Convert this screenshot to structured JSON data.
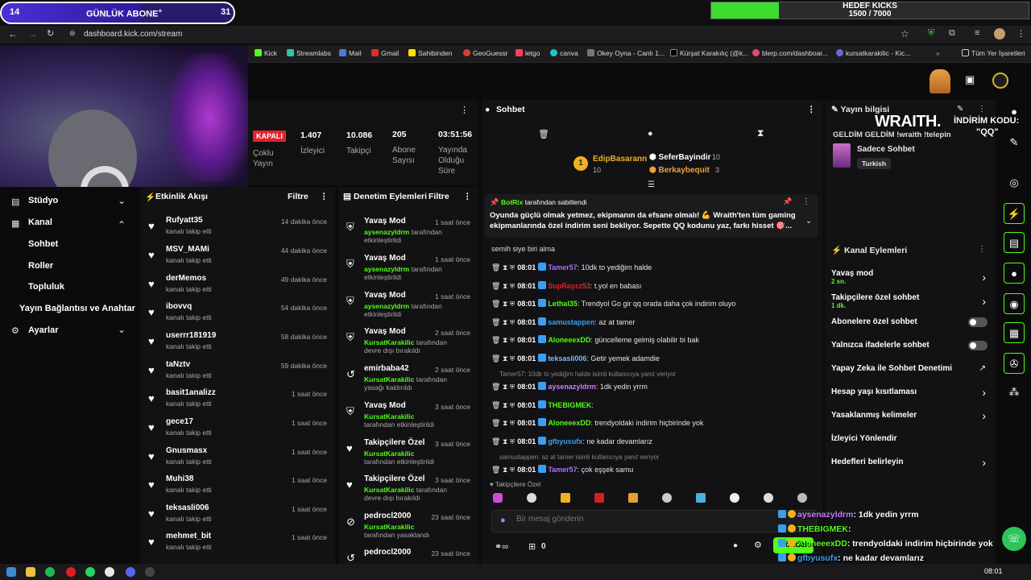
{
  "tab": {
    "left": "14",
    "middle": "GÜNLÜK ABONE",
    "middle_sup": "+",
    "right": "31",
    "progress": 0.6
  },
  "goal": {
    "title": "HEDEF KICKS",
    "value": "1500 / 7000",
    "progress": 0.214
  },
  "url": "dashboard.kick.com/stream",
  "bookmarks": [
    "Kick",
    "Streamlabs",
    "Mail",
    "Gmail",
    "Sahibinden",
    "GeoGuessr",
    "letgo",
    "canva",
    "Okey Oyna - Canlı 1...",
    "Kürşat Karakılıç (@k...",
    "blerp.com/dashboar...",
    "kursatkarakilic - Kic..."
  ],
  "bookmarks_folder": "Tüm Yer İşaretleri",
  "nav": {
    "studio": "Stüdyo",
    "kanal": "Kanal",
    "sohbet": "Sohbet",
    "roller": "Roller",
    "topluluk": "Topluluk",
    "yayin": "Yayın Bağlantısı ve Anahtar",
    "ayarlar": "Ayarlar"
  },
  "stats": {
    "status": "KAPALI",
    "status_label": "Çoklu Yayın",
    "viewers": "1.407",
    "viewers_label": "İzleyici",
    "followers": "10.086",
    "followers_label": "Takipçi",
    "subs": "205",
    "subs_label": "Abone Sayısı",
    "uptime": "03:51:56",
    "uptime_label": "Yayında Olduğu Süre"
  },
  "activity": {
    "title": "Etkinlik Akışı",
    "filter": "Filtre",
    "items": [
      {
        "name": "Rufyatt35",
        "sub": "kanalı takip etti",
        "time": "14 dakika önce"
      },
      {
        "name": "MSV_MAMi",
        "sub": "kanalı takip etti",
        "time": "44 dakika önce"
      },
      {
        "name": "derMemos",
        "sub": "kanalı takip etti",
        "time": "49 dakika önce"
      },
      {
        "name": "ibovvq",
        "sub": "kanalı takip etti",
        "time": "54 dakika önce"
      },
      {
        "name": "userrr181919",
        "sub": "kanalı takip etti",
        "time": "58 dakika önce"
      },
      {
        "name": "taNztv",
        "sub": "kanalı takip etti",
        "time": "59 dakika önce"
      },
      {
        "name": "basit1analizz",
        "sub": "kanalı takip etti",
        "time": "1 saat önce"
      },
      {
        "name": "gece17",
        "sub": "kanalı takip etti",
        "time": "1 saat önce"
      },
      {
        "name": "Gnusmasx",
        "sub": "kanalı takip etti",
        "time": "1 saat önce"
      },
      {
        "name": "Muhi38",
        "sub": "kanalı takip etti",
        "time": "1 saat önce"
      },
      {
        "name": "teksasli006",
        "sub": "kanalı takip etti",
        "time": "1 saat önce"
      },
      {
        "name": "mehmet_bit",
        "sub": "kanalı takip etti",
        "time": "1 saat önce"
      }
    ]
  },
  "mod": {
    "title": "Denetim Eylemleri",
    "filter": "Filtre",
    "items": [
      {
        "name": "Yavaş Mod",
        "user": "aysenazyldrm",
        "sub": " tarafından etkinleştirildi",
        "time": "1 saat önce"
      },
      {
        "name": "Yavaş Mod",
        "user": "aysenazyldrm",
        "sub": " tarafından etkinleştirildi",
        "time": "1 saat önce"
      },
      {
        "name": "Yavaş Mod",
        "user": "aysenazyldrm",
        "sub": " tarafından etkinleştirildi",
        "time": "1 saat önce"
      },
      {
        "name": "Yavaş Mod",
        "user": "KursatKarakilic",
        "sub": " tarafından devre dışı bırakıldı",
        "time": "2 saat önce"
      },
      {
        "name": "emirbaba42",
        "user": "KursatKarakilic",
        "sub": " tarafından yasağı kaldırıldı",
        "time": "2 saat önce"
      },
      {
        "name": "Yavaş Mod",
        "user": "KursatKarakilic",
        "sub": " tarafından etkinleştirildi",
        "time": "3 saat önce"
      },
      {
        "name": "Takipçilere Özel",
        "user": "KursatKarakilic",
        "sub": " tarafından etkinleştirildi",
        "time": "3 saat önce"
      },
      {
        "name": "Takipçilere Özel",
        "user": "KursatKarakilic",
        "sub": " tarafından devre dışı bırakıldı",
        "time": "3 saat önce"
      },
      {
        "name": "pedrocl2000",
        "user": "KursatKarakilic",
        "sub": " tarafından yasaklandı",
        "time": "23 saat önce"
      },
      {
        "name": "pedrocl2000",
        "user": "",
        "sub": "",
        "time": "23 saat önce"
      }
    ]
  },
  "chat": {
    "title": "Sohbet",
    "top": [
      {
        "name": "EdipBasarann",
        "n": "10"
      },
      {
        "name": "SeferBayindir",
        "n": "10"
      },
      {
        "name": "Berkaybequit",
        "n": "3"
      }
    ],
    "pinned": {
      "by": "BotRix",
      "by_label": " tarafından sabitlendi",
      "text": "Oyunda güçlü olmak yetmez, ekipmanın da efsane olmalı! 💪 Wraith'ten tüm gaming ekipmanlarında özel indirim seni bekliyor. Sepette QQ kodunu yaz, farkı hisset 🎯..."
    },
    "pre": "semih siye biri alma",
    "messages": [
      {
        "time": "08:01",
        "user": "Tamer57",
        "color": "#a970ff",
        "text": ": 10dk to yediğim halde"
      },
      {
        "time": "08:01",
        "user": "SupRayzz53",
        "color": "#e0222e",
        "text": ": t.yol en babası"
      },
      {
        "time": "08:01",
        "user": "Lethal35",
        "color": "#53fc18",
        "text": ": Trendyol Go gir qq orada daha çok indirim oluyo"
      },
      {
        "time": "08:01",
        "user": "samustappen",
        "color": "#3a9ff0",
        "text": ": az at tamer"
      },
      {
        "time": "08:01",
        "user": "AloneeexDD",
        "color": "#53fc18",
        "text": ": güncelleme gelmiş olabilir bi bak"
      },
      {
        "time": "08:01",
        "user": "teksasli006",
        "color": "#7eb8ff",
        "text": ": Getir yemek adamdie"
      },
      {
        "reply": "Tamer57: 10dk to yediğim halde isimli kullanıcıya yanıt veriyor"
      },
      {
        "time": "08:01",
        "user": "aysenazyldrm",
        "color": "#d17bff",
        "text": ": 1dk yedin yrrm"
      },
      {
        "time": "08:01",
        "user": "THEBIGMEK",
        "color": "#53fc18",
        "text": ": "
      },
      {
        "time": "08:01",
        "user": "AloneeexDD",
        "color": "#53fc18",
        "text": ": trendyoldaki indirim hiçbirinde yok"
      },
      {
        "time": "08:01",
        "user": "gfbyusufx",
        "color": "#3a9ff0",
        "text": ": ne kadar devamlarız"
      },
      {
        "reply": "samustappen: az at tamer isimli kullanıcıya yanıt veriyor"
      },
      {
        "time": "08:01",
        "user": "Tamer57",
        "color": "#a970ff",
        "text": ": çok eşşek samu"
      }
    ],
    "follower_only": "Takipçilere Özel",
    "input_placeholder": "Bir mesaj gönderin",
    "count": "0",
    "send": "Gönder"
  },
  "info": {
    "title": "Yayın bilgisi",
    "stream_title": "GELDİM GELDİM !wraith !telepin",
    "category": "Sadece Sohbet",
    "tag": "Turkish"
  },
  "actions": {
    "title": "Kanal Eylemleri",
    "items": [
      {
        "label": "Yavaş mod",
        "sub": "2 sn.",
        "type": "chev"
      },
      {
        "label": "Takipçilere özel sohbet",
        "sub": "1 dk.",
        "type": "chev"
      },
      {
        "label": "Abonelere özel sohbet",
        "sub": "",
        "type": "toggle"
      },
      {
        "label": "Yalnızca ifadelerle sohbet",
        "sub": "",
        "type": "toggle"
      },
      {
        "label": "Yapay Zeka ile Sohbet Denetimi",
        "sub": "",
        "type": "ext"
      },
      {
        "label": "Hesap yaşı kısıtlaması",
        "sub": "",
        "type": "chev"
      },
      {
        "label": "Yasaklanmış kelimeler",
        "sub": "",
        "type": "chev"
      },
      {
        "label": "İzleyici Yönlendir",
        "sub": "",
        "type": "none"
      },
      {
        "label": "Hedefleri belirleyin",
        "sub": "",
        "type": "chev"
      }
    ]
  },
  "overlay": {
    "brand": "WRAITH.",
    "promo": "İNDİRİM KODU:",
    "code": "\"QQ\"",
    "chat": [
      {
        "user": "aysenazyldrm",
        "color": "#c77dff",
        "text": ": 1dk yedin yrrm"
      },
      {
        "user": "THEBIGMEK",
        "color": "#53fc18",
        "text": ":"
      },
      {
        "user": "AloneeexDD",
        "color": "#53fc18",
        "text": ": trendyoldaki indirim hiçbirinde yok"
      },
      {
        "user": "gfbyusufx",
        "color": "#3a9ff0",
        "text": ": ne kadar devamlarız"
      },
      {
        "user": "Tamer57",
        "color": "#53fc18",
        "text": ": çok eşşek samu"
      }
    ]
  },
  "clock": "08:01",
  "colors": {
    "accent": "#53fc18",
    "purple": "#4b2fd6"
  }
}
